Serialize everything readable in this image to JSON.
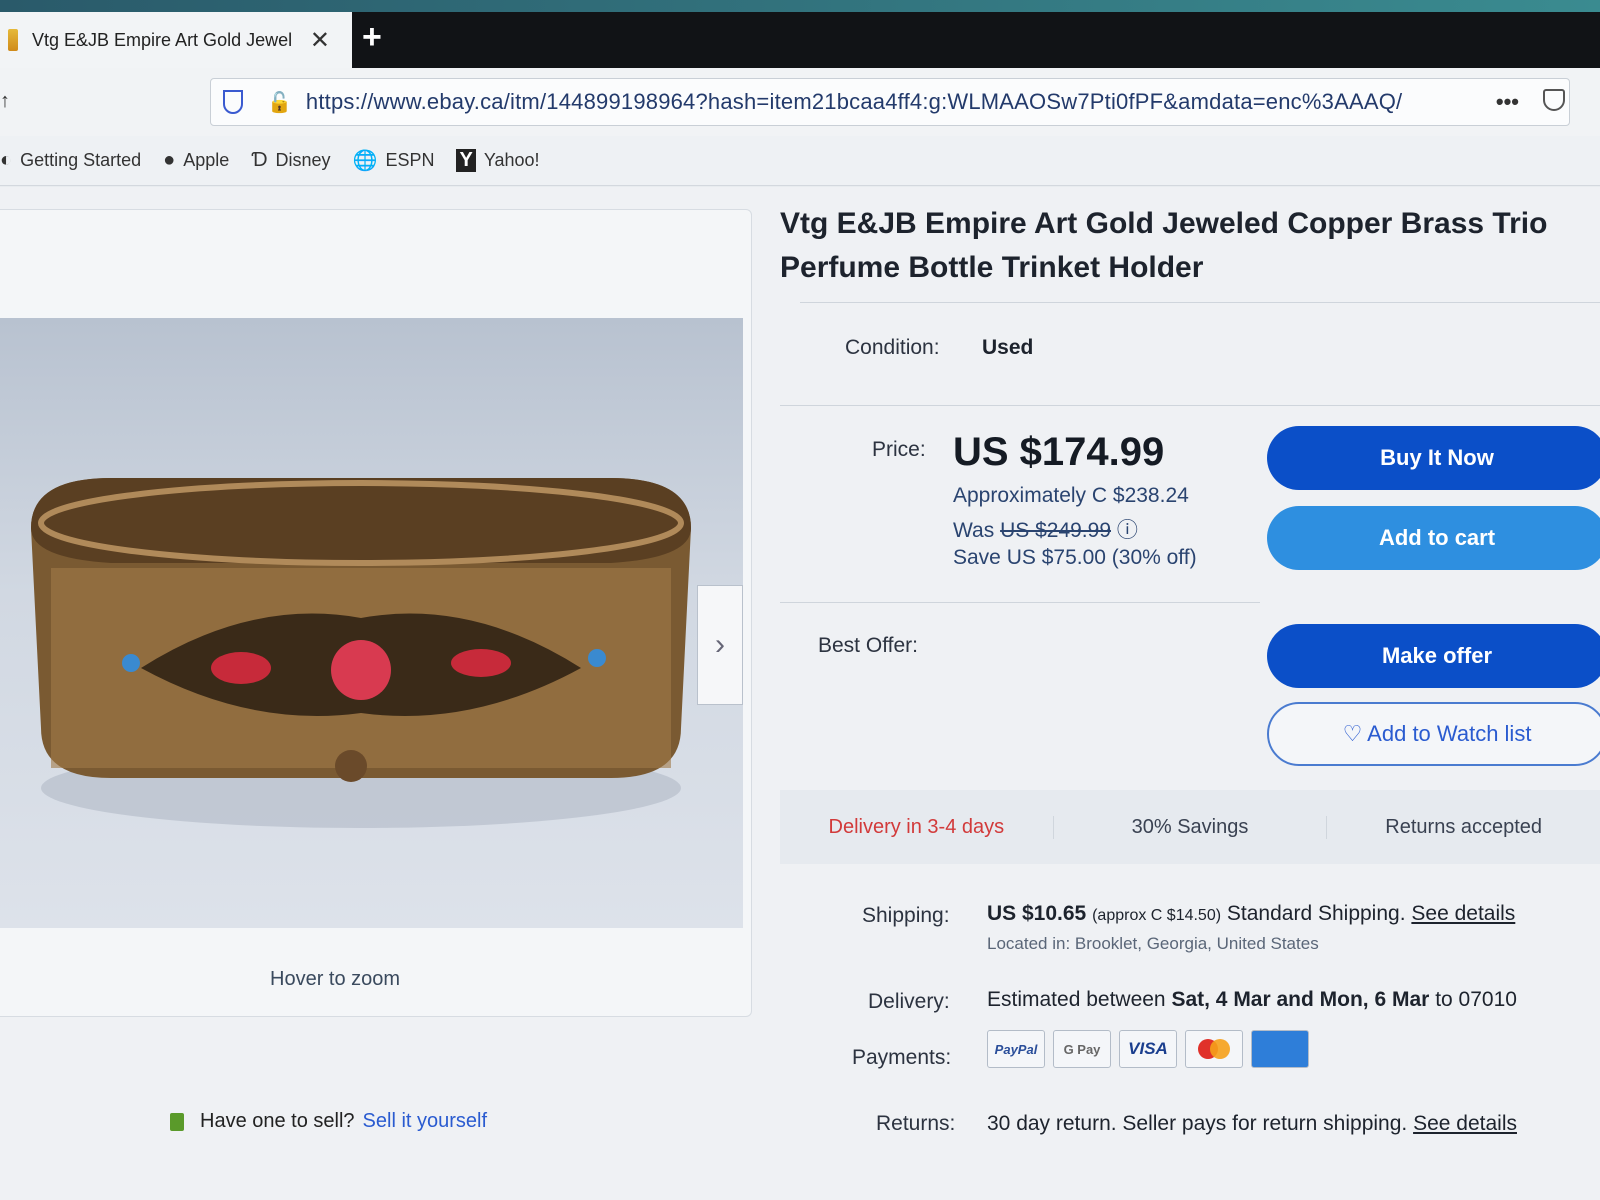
{
  "browser": {
    "tab_title": "Vtg E&JB Empire Art Gold Jewel",
    "new_tab_label": "+",
    "close_label": "✕",
    "url": "https://www.ebay.ca/itm/144899198964?hash=item21bcaa4ff4:g:WLMAAOSw7Pti0fPF&amdata=enc%3AAAQ/",
    "more_label": "•••",
    "bookmarks": [
      "Getting Started",
      "Apple",
      "Disney",
      "ESPN",
      "Yahoo!"
    ]
  },
  "gallery": {
    "hover_label": "Hover to zoom",
    "next_label": "›"
  },
  "sell": {
    "prompt": "Have one to sell?",
    "link": "Sell it yourself"
  },
  "product": {
    "title": "Vtg E&JB Empire Art Gold Jeweled Copper Brass Trio Perfume Bottle Trinket Holder",
    "condition_label": "Condition:",
    "condition_value": "Used",
    "price_label": "Price:",
    "price": "US $174.99",
    "approx": "Approximately C $238.24",
    "was_label": "Was",
    "was_price": "US $249.99",
    "save": "Save US $75.00 (30% off)",
    "best_offer_label": "Best Offer:"
  },
  "buttons": {
    "buy_now": "Buy It Now",
    "add_to_cart": "Add to cart",
    "make_offer": "Make offer",
    "watch": "♡ Add to Watch list"
  },
  "perks": [
    "Delivery in 3-4 days",
    "30% Savings",
    "Returns accepted"
  ],
  "shipping": {
    "label": "Shipping:",
    "price": "US $10.65",
    "approx": "(approx C $14.50)",
    "method": "Standard Shipping.",
    "details_link": "See details",
    "located": "Located in: Brooklet, Georgia, United States"
  },
  "delivery": {
    "label": "Delivery:",
    "prefix": "Estimated between",
    "dates": "Sat, 4 Mar and Mon, 6 Mar",
    "suffix": "to 07010"
  },
  "payments": {
    "label": "Payments:",
    "methods": [
      "PayPal",
      "G Pay",
      "VISA",
      "",
      ""
    ]
  },
  "returns": {
    "label": "Returns:",
    "text": "30 day return. Seller pays for return shipping.",
    "details_link": "See details"
  }
}
